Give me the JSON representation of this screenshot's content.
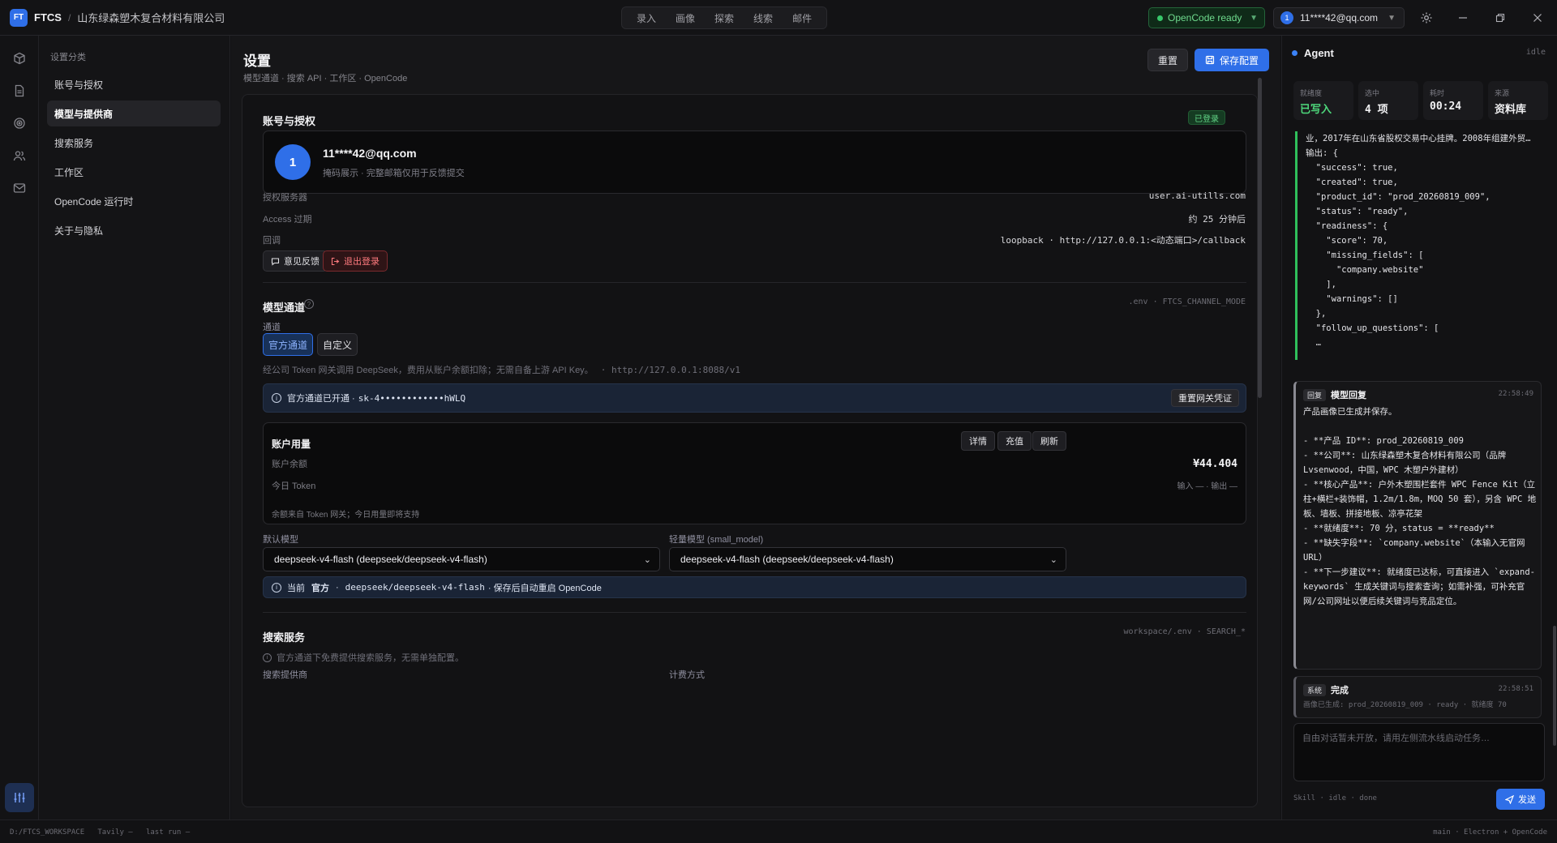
{
  "app": {
    "logo": "FT",
    "brand": "FTCS",
    "separator": "/",
    "company": "山东绿森塑木复合材料有限公司"
  },
  "topnav": [
    "录入",
    "画像",
    "探索",
    "线索",
    "邮件"
  ],
  "opencode_status": "OpenCode ready",
  "user": {
    "initial": "1",
    "email": "11****42@qq.com"
  },
  "sidebar": {
    "title": "设置分类",
    "items": [
      {
        "label": "账号与授权"
      },
      {
        "label": "模型与提供商"
      },
      {
        "label": "搜索服务"
      },
      {
        "label": "工作区"
      },
      {
        "label": "OpenCode 运行时"
      },
      {
        "label": "关于与隐私"
      }
    ]
  },
  "page": {
    "title": "设置",
    "subtitle": "模型通道 · 搜索 API · 工作区 · OpenCode",
    "reset_label": "重置",
    "save_label": "保存配置"
  },
  "account": {
    "title": "账号与授权",
    "badge": "已登录",
    "initial": "1",
    "email": "11****42@qq.com",
    "hint": "掩码展示 · 完整邮箱仅用于反馈提交",
    "rows": [
      {
        "label": "授权服务器",
        "value": "user.ai-utills.com"
      },
      {
        "label": "Access 过期",
        "value": "约 25 分钟后"
      },
      {
        "label": "回调",
        "value": "loopback · http://127.0.0.1:<动态端口>/callback"
      }
    ],
    "feedback_label": "意见反馈",
    "logout_label": "退出登录"
  },
  "model_channel": {
    "title": "模型通道",
    "env_note": ".env · FTCS_CHANNEL_MODE",
    "channel_label": "通道",
    "options": [
      "官方通道",
      "自定义"
    ],
    "description": "经公司 Token 网关调用 DeepSeek，费用从账户余额扣除；无需自备上游 API Key。",
    "endpoint": "· http://127.0.0.1:8088/v1",
    "info_prefix": "官方通道已开通 ·",
    "info_key": "sk-4••••••••••••hWLQ",
    "info_button": "重置网关凭证",
    "usage": {
      "title": "账户用量",
      "buttons": [
        "详情",
        "充值",
        "刷新"
      ],
      "balance_label": "账户余额",
      "balance_value": "¥44.404",
      "token_label": "今日 Token",
      "token_value": "输入 — · 输出 —",
      "note": "余额来自 Token 网关；今日用量即将支持"
    },
    "default_model_label": "默认模型",
    "default_model_value": "deepseek-v4-flash (deepseek/deepseek-v4-flash)",
    "small_model_label": "轻量模型 (small_model)",
    "small_model_value": "deepseek-v4-flash (deepseek/deepseek-v4-flash)",
    "current_prefix": "当前",
    "current_channel": "官方",
    "current_model": "deepseek/deepseek-v4-flash",
    "current_suffix": "· 保存后自动重启 OpenCode"
  },
  "search": {
    "title": "搜索服务",
    "env_note": "workspace/.env · SEARCH_*",
    "note": "官方通道下免费提供搜索服务，无需单独配置。",
    "provider_label": "搜索提供商",
    "billing_label": "计费方式"
  },
  "agent": {
    "title": "Agent",
    "status": "idle",
    "stats": [
      {
        "label": "就绪度",
        "value": "已写入"
      },
      {
        "label": "选中",
        "value": "4 项"
      },
      {
        "label": "耗时",
        "value": "00:24"
      },
      {
        "label": "来源",
        "value": "资料库"
      }
    ],
    "log_text": "业，2017年在山东省股权交易中心挂牌。2008年组建外贸…\n输出: {\n  \"success\": true,\n  \"created\": true,\n  \"product_id\": \"prod_20260819_009\",\n  \"status\": \"ready\",\n  \"readiness\": {\n    \"score\": 70,\n    \"missing_fields\": [\n      \"company.website\"\n    ],\n    \"warnings\": []\n  },\n  \"follow_up_questions\": [\n  …",
    "reply": {
      "tag": "回复",
      "title": "模型回复",
      "time": "22:58:49",
      "body": "产品画像已生成并保存。\n\n- **产品 ID**: prod_20260819_009\n- **公司**: 山东绿森塑木复合材料有限公司（品牌 Lvsenwood，中国，WPC 木塑户外建材）\n- **核心产品**: 户外木塑围栏套件 WPC Fence Kit（立柱+横栏+装饰帽，1.2m/1.8m，MOQ 50 套），另含 WPC 地板、墙板、拼接地板、凉亭花架\n- **就绪度**: 70 分，status = **ready**\n- **缺失字段**: `company.website`（本输入无官网 URL）\n- **下一步建议**: 就绪度已达标，可直接进入 `expand-keywords` 生成关键词与搜索查询；如需补强，可补充官网/公司网址以便后续关键词与竞品定位。"
    },
    "system": {
      "tag": "系统",
      "title": "完成",
      "time": "22:58:51",
      "body": "画像已生成: prod_20260819_009 · ready · 就绪度 70"
    },
    "composer_placeholder": "自由对话暂未开放，请用左侧流水线启动任务…",
    "composer_foot": "Skill · idle · done",
    "send_label": "发送"
  },
  "statusbar": {
    "left": "D:/FTCS_WORKSPACE   Tavily —   last run —",
    "right": "main · Electron + OpenCode"
  },
  "colors": {
    "accent": "#2f6fe8",
    "success": "#37c76a",
    "danger": "#ff7a7e"
  }
}
